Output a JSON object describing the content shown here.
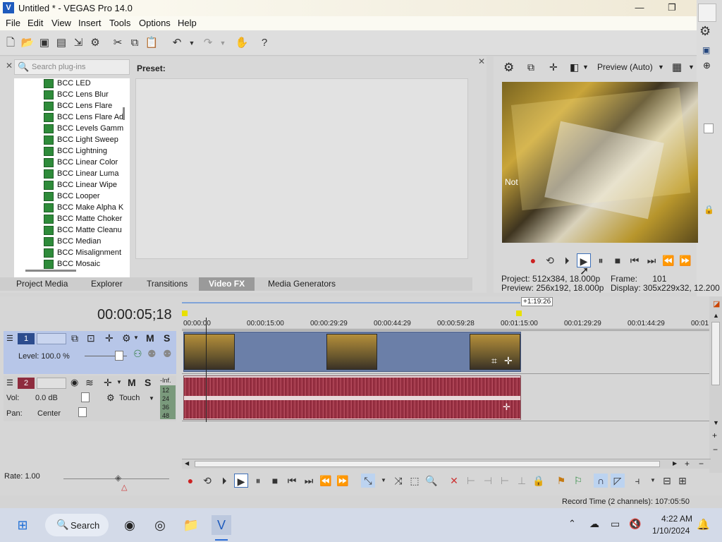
{
  "window": {
    "title": "Untitled * - VEGAS Pro 14.0",
    "min": "—",
    "max": "❐",
    "close": "✕"
  },
  "menu": [
    "File",
    "Edit",
    "View",
    "Insert",
    "Tools",
    "Options",
    "Help"
  ],
  "plugins": {
    "search_placeholder": "Search plug-ins",
    "preset_label": "Preset:",
    "items": [
      "BCC LED",
      "BCC Lens Blur",
      "BCC Lens Flare",
      "BCC Lens Flare Ad",
      "BCC Levels Gamm",
      "BCC Light Sweep",
      "BCC Lightning",
      "BCC Linear Color",
      "BCC Linear Luma",
      "BCC Linear Wipe",
      "BCC Looper",
      "BCC Make Alpha K",
      "BCC Matte Choker",
      "BCC Matte Cleanu",
      "BCC Median",
      "BCC Misalignment",
      "BCC Mosaic"
    ]
  },
  "tabs": [
    "Project Media",
    "Explorer",
    "Transitions",
    "Video FX",
    "Media Generators"
  ],
  "active_tab": "Video FX",
  "preview": {
    "mode": "Preview (Auto)",
    "project_label": "Project:",
    "project_value": "512x384, 18.000p",
    "preview_label": "Preview:",
    "preview_value": "256x192, 18.000p",
    "frame_label": "Frame:",
    "frame_value": "101",
    "display_label": "Display:",
    "display_value": "305x229x32, 12.200",
    "overlay_text": "Not"
  },
  "timeline": {
    "timecode": "00:00:05;18",
    "loop_marker": "+1:19:26",
    "ruler": [
      "00:00:00",
      "00:00:15:00",
      "00:00:29:29",
      "00:00:44:29",
      "00:00:59:28",
      "00:01:15:00",
      "00:01:29:29",
      "00:01:44:29",
      "00:01:"
    ],
    "track1": {
      "number": "1",
      "level": "Level: 100.0 %",
      "m": "M",
      "s": "S"
    },
    "track2": {
      "number": "2",
      "vol_label": "Vol:",
      "vol_value": "0.0 dB",
      "pan_label": "Pan:",
      "pan_value": "Center",
      "mode": "Touch",
      "m": "M",
      "s": "S",
      "meter_top": "-Inf.",
      "meter_ticks": [
        "12",
        "24",
        "36",
        "48"
      ]
    },
    "rate": "Rate: 1.00",
    "record_time": "Record Time (2 channels): 107:05:50"
  },
  "taskbar": {
    "search": "Search",
    "time": "4:22 AM",
    "date": "1/10/2024"
  }
}
